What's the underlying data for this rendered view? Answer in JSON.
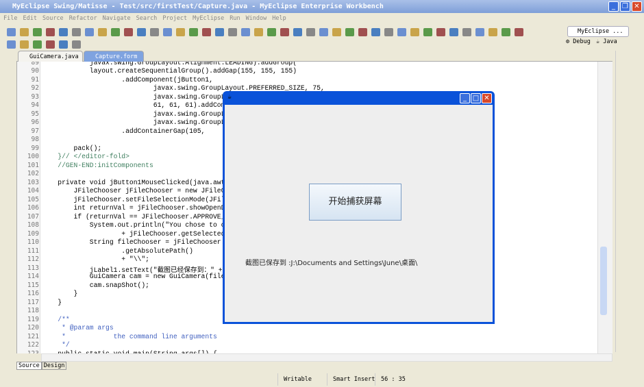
{
  "window": {
    "title": "MyEclipse Swing/Matisse - Test/src/firstTest/Capture.java - MyEclipse Enterprise Workbench"
  },
  "menu": [
    "File",
    "Edit",
    "Source",
    "Refactor",
    "Navigate",
    "Search",
    "Project",
    "MyEclipse",
    "Run",
    "Window",
    "Help"
  ],
  "perspectives": {
    "current": "MyEclipse ...",
    "debug": "Debug",
    "java": "Java"
  },
  "tabs": [
    {
      "label": "GuiCamera.java",
      "active": false
    },
    {
      "label": "Capture.form",
      "active": true
    }
  ],
  "editor": {
    "lines": [
      {
        "n": "89",
        "t": "            javax.swing.GroupLayout.Alignment.LEADING).addGroup("
      },
      {
        "n": "90",
        "t": "            layout.createSequentialGroup().addGap(155, 155, 155)"
      },
      {
        "n": "91",
        "t": "                    .addComponent(jButton1,"
      },
      {
        "n": "92",
        "t": "                            javax.swing.GroupLayout.PREFERRED_SIZE, 75,"
      },
      {
        "n": "93",
        "t": "                            javax.swing.GroupLayout.PREFERRED_SIZE)"
      },
      {
        "n": "94",
        "t": "                            61, 61, 61).addComponent("
      },
      {
        "n": "95",
        "t": "                            javax.swing.GroupLayout.DEFAULT_SIZE"
      },
      {
        "n": "96",
        "t": "                            javax.swing.GroupLayout.DEFAULT_SIZE"
      },
      {
        "n": "97",
        "t": "                    .addContainerGap(105,"
      },
      {
        "n": "98",
        "t": ""
      },
      {
        "n": "99",
        "t": "        pack();"
      },
      {
        "n": "100",
        "t": "    }// </editor-fold>"
      },
      {
        "n": "101",
        "t": "    //GEN-END:initComponents"
      },
      {
        "n": "102",
        "t": ""
      },
      {
        "n": "103",
        "t": "    private void jButton1MouseClicked(java.awt.event.MouseEvent evt) {"
      },
      {
        "n": "104",
        "t": "        JFileChooser jFileChooser = new JFileChooser();"
      },
      {
        "n": "105",
        "t": "        jFileChooser.setFileSelectionMode(JFileChooser.DIRECTORIES_ONLY);"
      },
      {
        "n": "106",
        "t": "        int returnVal = jFileChooser.showOpenDialog(this);"
      },
      {
        "n": "107",
        "t": "        if (returnVal == JFileChooser.APPROVE_OPTION) {"
      },
      {
        "n": "108",
        "t": "            System.out.println(\"You chose to open this file: \""
      },
      {
        "n": "109",
        "t": "                    + jFileChooser.getSelectedFile().getName());"
      },
      {
        "n": "110",
        "t": "            String fileChooser = jFileChooser.getSelectedFile()"
      },
      {
        "n": "111",
        "t": "                    .getAbsolutePath()"
      },
      {
        "n": "112",
        "t": "                    + \"\\\\\";"
      },
      {
        "n": "113",
        "t": "            jLabel1.setText(\"截图已经保存到：\" + fileChooser);"
      },
      {
        "n": "114",
        "t": "            GuiCamera cam = new GuiCamera(fileChooser, \"png\");"
      },
      {
        "n": "115",
        "t": "            cam.snapShot();"
      },
      {
        "n": "116",
        "t": "        }"
      },
      {
        "n": "117",
        "t": "    }"
      },
      {
        "n": "118",
        "t": ""
      },
      {
        "n": "119",
        "t": "    /**"
      },
      {
        "n": "120",
        "t": "     * @param args"
      },
      {
        "n": "121",
        "t": "     *            the command line arguments"
      },
      {
        "n": "122",
        "t": "     */"
      },
      {
        "n": "123",
        "t": "    public static void main(String args[]) {"
      }
    ]
  },
  "bottom_tabs": [
    "Source",
    "Design"
  ],
  "dialog": {
    "button": "开始捕获屏幕",
    "label": "截图已保存到 :J:\\Documents and Settings\\June\\桌面\\"
  },
  "status": {
    "mode": "Writable",
    "insert": "Smart Insert",
    "position": "56 : 35"
  }
}
